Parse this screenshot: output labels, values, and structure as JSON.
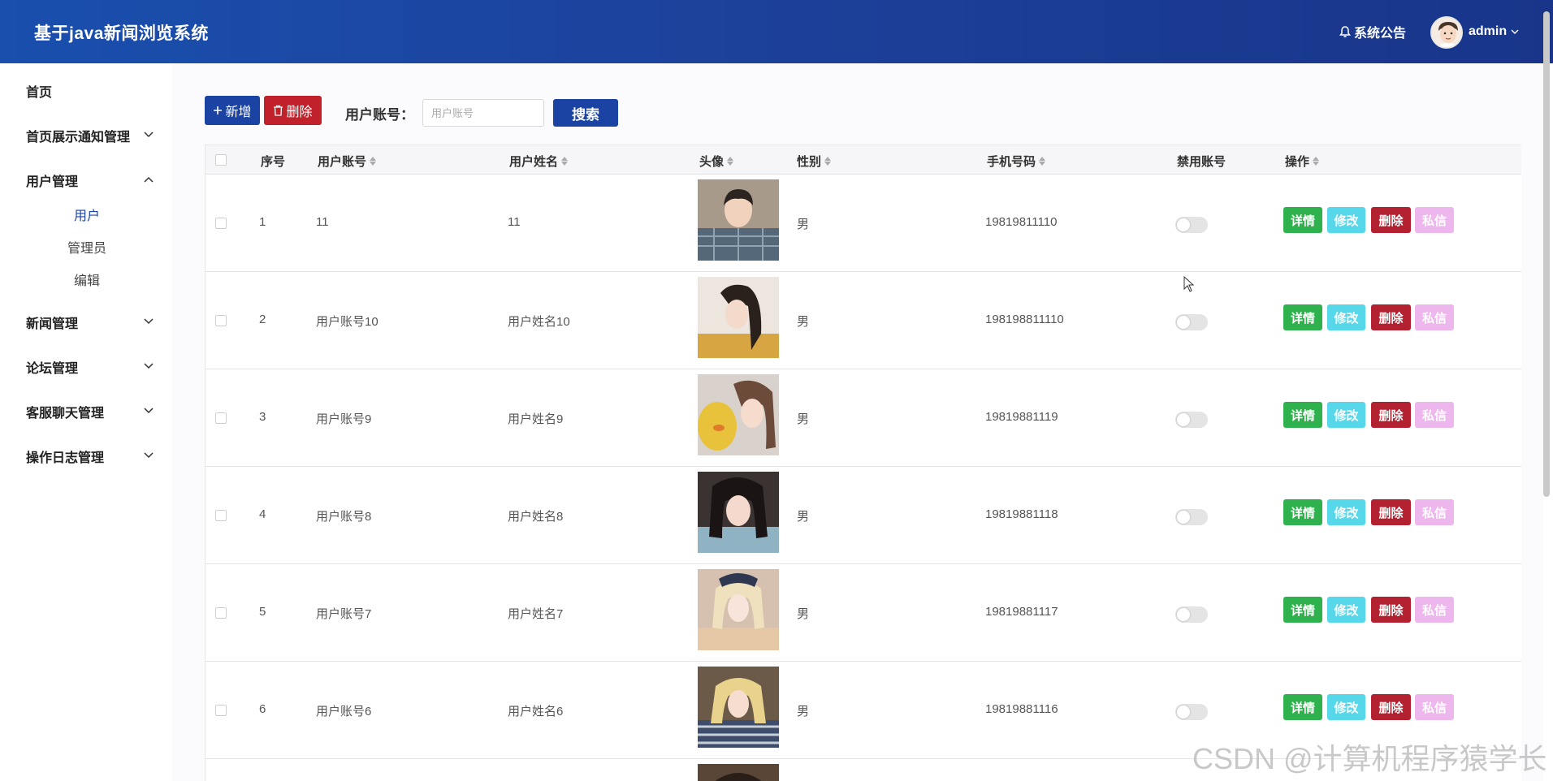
{
  "header": {
    "app_title": "基于java新闻浏览系统",
    "notice_label": "系统公告",
    "username": "admin"
  },
  "sidebar": {
    "items": [
      {
        "label": "首页",
        "expandable": false
      },
      {
        "label": "首页展示通知管理",
        "expandable": true
      },
      {
        "label": "用户管理",
        "expandable": true,
        "expanded": true
      },
      {
        "label": "新闻管理",
        "expandable": true
      },
      {
        "label": "论坛管理",
        "expandable": true
      },
      {
        "label": "客服聊天管理",
        "expandable": true
      },
      {
        "label": "操作日志管理",
        "expandable": true
      }
    ],
    "sub_items": [
      {
        "label": "用户",
        "active": true
      },
      {
        "label": "管理员",
        "active": false
      },
      {
        "label": "编辑",
        "active": false
      }
    ]
  },
  "toolbar": {
    "add_label": "新增",
    "delete_label": "删除",
    "search_label": "用户账号：",
    "search_placeholder": "用户账号",
    "search_button": "搜索"
  },
  "table": {
    "columns": [
      "序号",
      "用户账号",
      "用户姓名",
      "头像",
      "性别",
      "手机号码",
      "禁用账号",
      "操作"
    ],
    "rows": [
      {
        "index": "1",
        "account": "11",
        "name": "11",
        "gender": "男",
        "phone": "19819811110"
      },
      {
        "index": "2",
        "account": "用户账号10",
        "name": "用户姓名10",
        "gender": "男",
        "phone": "198198811110"
      },
      {
        "index": "3",
        "account": "用户账号9",
        "name": "用户姓名9",
        "gender": "男",
        "phone": "19819881119"
      },
      {
        "index": "4",
        "account": "用户账号8",
        "name": "用户姓名8",
        "gender": "男",
        "phone": "19819881118"
      },
      {
        "index": "5",
        "account": "用户账号7",
        "name": "用户姓名7",
        "gender": "男",
        "phone": "19819881117"
      },
      {
        "index": "6",
        "account": "用户账号6",
        "name": "用户姓名6",
        "gender": "男",
        "phone": "19819881116"
      }
    ],
    "actions": {
      "detail": "详情",
      "edit": "修改",
      "delete": "删除",
      "message": "私信"
    }
  },
  "colors": {
    "header_bg": "#1c3f98",
    "primary": "#1b43a3",
    "danger": "#c0212b",
    "success": "#2fb14d",
    "info": "#56d7ea",
    "pink": "#edb7ee"
  },
  "watermark": "CSDN @计算机程序猿学长"
}
